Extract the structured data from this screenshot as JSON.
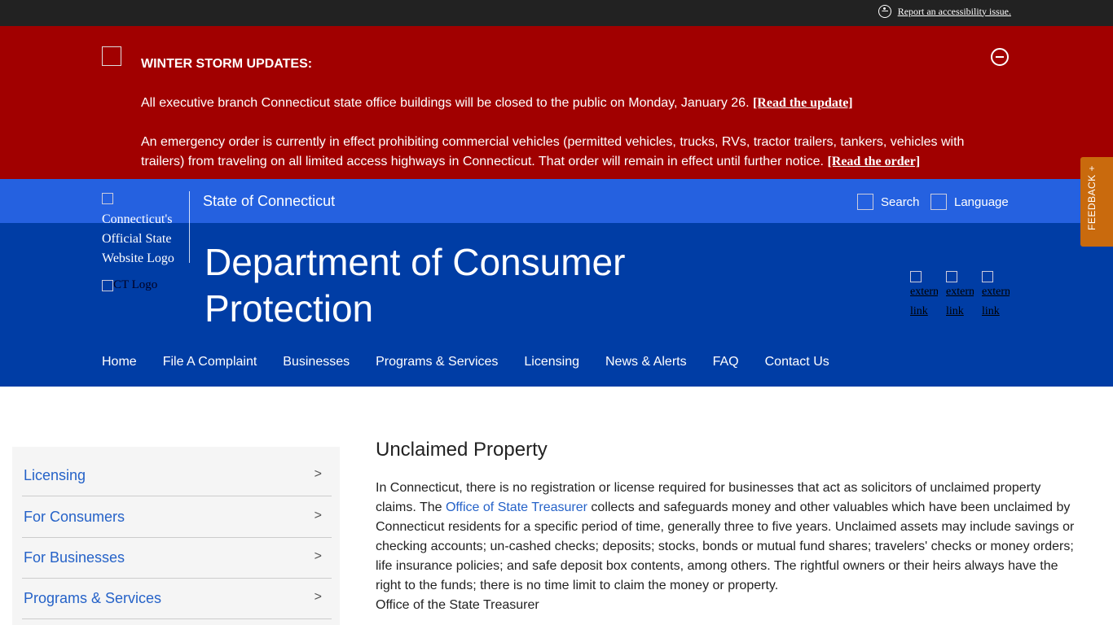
{
  "top_bar": {
    "accessibility_link": "Report an accessibility issue."
  },
  "alert": {
    "title": "WINTER STORM UPDATES:",
    "p1_text": "All executive branch Connecticut state office buildings will be closed to the public on Monday, January 26. ",
    "p1_link": "[Read the update]",
    "p2_text": "An emergency order is currently in effect prohibiting commercial vehicles (permitted vehicles, trucks, RVs, tractor trailers, tankers, vehicles with trailers) from traveling on all limited access highways in Connecticut. That order will remain in effect until further notice. ",
    "p2_link": "[Read the order]"
  },
  "header": {
    "logo_alt": "Connecticut's Official State Website Logo",
    "state_name": "State of Connecticut",
    "search_label": "Search",
    "language_label": "Language",
    "dept_title": "Department of Consumer Protection",
    "ct_logo_alt": "CT Logo",
    "social_alt": [
      "external link",
      "external link",
      "external link"
    ]
  },
  "nav": [
    "Home",
    "File A Complaint",
    "Businesses",
    "Programs & Services",
    "Licensing",
    "News & Alerts",
    "FAQ",
    "Contact Us"
  ],
  "feedback_label": "FEEDBACK +",
  "sidebar": {
    "items": [
      {
        "label": "Licensing",
        "arrow": ">"
      },
      {
        "label": "For Consumers",
        "arrow": ">"
      },
      {
        "label": "For Businesses",
        "arrow": ">"
      },
      {
        "label": "Programs & Services",
        "arrow": ">"
      }
    ]
  },
  "content": {
    "title": "Unclaimed Property",
    "p_before": "In Connecticut, there is no registration or license required for businesses that act as solicitors of unclaimed property claims. The ",
    "p_link": "Office of State Treasurer",
    "p_after": " collects and safeguards money and other valuables which have been unclaimed by Connecticut residents for a specific period of time, generally three to five years. Unclaimed assets may include savings or checking accounts; un-cashed checks; deposits; stocks, bonds or mutual fund shares; travelers' checks or money orders; life insurance policies; and safe deposit box contents, among others. The rightful owners or their heirs always have the right to the funds; there is no time limit to claim the money or property.",
    "p_tail": "Office of the State Treasurer"
  }
}
